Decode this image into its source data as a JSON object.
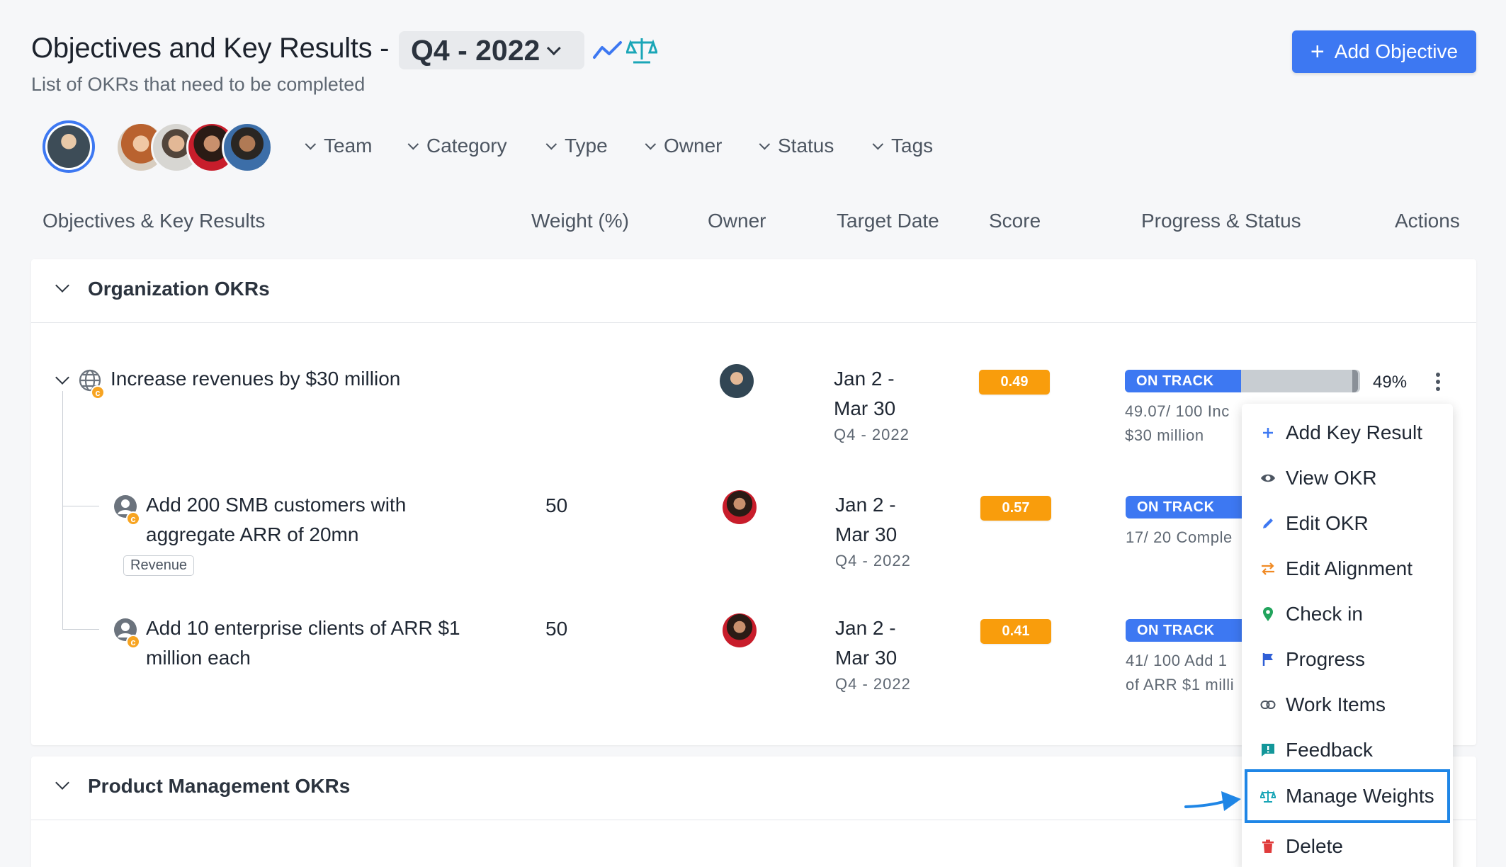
{
  "header": {
    "title": "Objectives and Key Results -",
    "period": "Q4 - 2022",
    "subtitle": "List of OKRs that need to be completed",
    "add_objective_label": "Add Objective",
    "add_objective_icon": "plus-icon",
    "accent_color": "#3d78f2"
  },
  "filters": [
    "Team",
    "Category",
    "Type",
    "Owner",
    "Status",
    "Tags"
  ],
  "columns": {
    "okr": "Objectives & Key Results",
    "weight": "Weight (%)",
    "owner": "Owner",
    "target_date": "Target Date",
    "score": "Score",
    "progress": "Progress & Status",
    "actions": "Actions"
  },
  "sections": [
    {
      "label": "Organization OKRs",
      "objective": {
        "title": "Increase revenues by $30 million",
        "date_line1": "Jan 2 -",
        "date_line2": "Mar 30",
        "quarter": "Q4 - 2022",
        "score": "0.49",
        "status": "ON TRACK",
        "progress_percent": 49,
        "percent_label": "49%",
        "note_line1": "49.07/ 100  Inc",
        "note_line2": "$30 million"
      },
      "key_results": [
        {
          "title_line1": "Add 200 SMB customers with",
          "title_line2": "aggregate ARR of 20mn",
          "tag": "Revenue",
          "weight": "50",
          "date_line1": "Jan 2 -",
          "date_line2": "Mar 30",
          "quarter": "Q4 - 2022",
          "score": "0.57",
          "status": "ON TRACK",
          "note_line1": "17/ 20  Comple"
        },
        {
          "title_line1": "Add 10 enterprise clients of ARR $1",
          "title_line2": "million each",
          "weight": "50",
          "date_line1": "Jan 2 -",
          "date_line2": "Mar 30",
          "quarter": "Q4 - 2022",
          "score": "0.41",
          "status": "ON TRACK",
          "note_line1": "41/ 100  Add 1",
          "note_line2": "of ARR $1 milli"
        }
      ]
    },
    {
      "label": "Product Management OKRs"
    }
  ],
  "menu": {
    "items": [
      {
        "label": "Add Key Result",
        "icon": "plus-icon"
      },
      {
        "label": "View OKR",
        "icon": "eye-icon"
      },
      {
        "label": "Edit OKR",
        "icon": "pencil-icon"
      },
      {
        "label": "Edit Alignment",
        "icon": "swap-arrows-icon"
      },
      {
        "label": "Check in",
        "icon": "map-pin-icon"
      },
      {
        "label": "Progress",
        "icon": "flag-icon"
      },
      {
        "label": "Work Items",
        "icon": "link-icon"
      },
      {
        "label": "Feedback",
        "icon": "feedback-icon"
      },
      {
        "label": "Manage Weights",
        "icon": "scale-icon"
      },
      {
        "label": "Delete",
        "icon": "trash-icon"
      }
    ]
  }
}
